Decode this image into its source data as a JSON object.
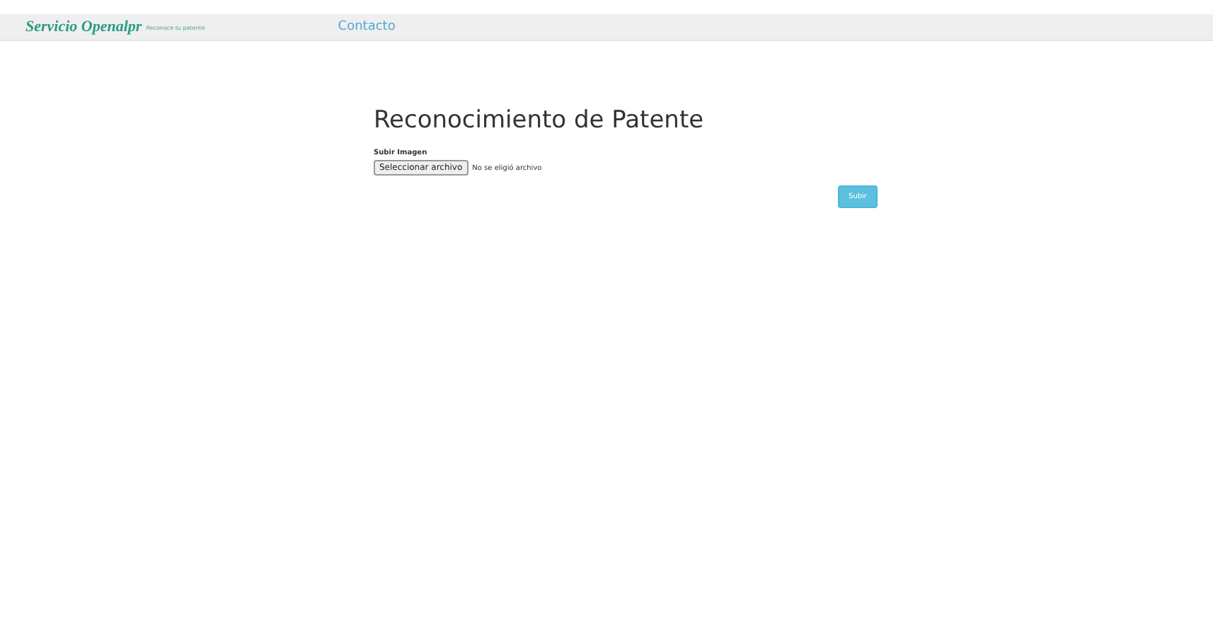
{
  "navbar": {
    "brand": "Servicio Openalpr",
    "tagline": "Reconoce tu patente",
    "links": [
      "Contacto"
    ]
  },
  "form": {
    "title": "Reconocimiento de Patente",
    "label": "Subir Imagen",
    "file_button": "Seleccionar archivo",
    "file_status": "No se eligió archivo",
    "submit": "Subir"
  }
}
